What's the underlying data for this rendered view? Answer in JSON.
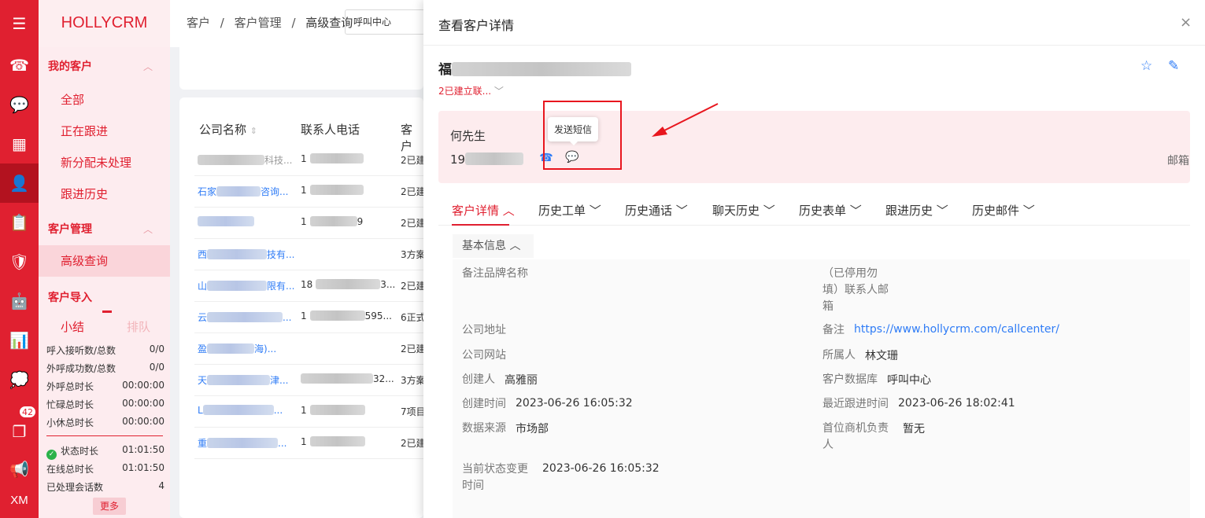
{
  "brand": {
    "logo": "HOLLYCRM"
  },
  "rail": {
    "badge": "42",
    "user_initials": "XM"
  },
  "sidebar": {
    "group_my": "我的客户",
    "my_items": [
      "全部",
      "正在跟进",
      "新分配未处理",
      "跟进历史"
    ],
    "group_manage": "客户管理",
    "manage_items": [
      "高级查询"
    ],
    "group_import": "客户导入"
  },
  "summary": {
    "tab_summary": "小结",
    "tab_queue": "排队",
    "stats": [
      {
        "label": "呼入接听数/总数",
        "value": "0/0"
      },
      {
        "label": "外呼成功数/总数",
        "value": "0/0"
      },
      {
        "label": "外呼总时长",
        "value": "00:00:00"
      },
      {
        "label": "忙碌总时长",
        "value": "00:00:00"
      },
      {
        "label": "小休总时长",
        "value": "00:00:00"
      }
    ],
    "stats2": [
      {
        "label": "状态时长",
        "value": "01:01:50"
      },
      {
        "label": "在线总时长",
        "value": "01:01:50"
      },
      {
        "label": "已处理会话数",
        "value": "4"
      }
    ],
    "more": "更多"
  },
  "breadcrumb": {
    "a": "客户",
    "sep": "/",
    "b": "客户管理",
    "c": "高级查询"
  },
  "top_select": "呼叫中心",
  "table": {
    "headers": [
      "公司名称",
      "联系人电话",
      "客户"
    ],
    "rows": [
      {
        "name": "科技...",
        "phone": "1",
        "status": "2已建"
      },
      {
        "name": "石家",
        "name_tail": "咨询...",
        "phone": "1",
        "status": "2已建"
      },
      {
        "name": "",
        "name_tail": "",
        "phone": "1",
        "phone_tail": "9",
        "status": "2已建"
      },
      {
        "name": "西",
        "name_tail": "技有...",
        "phone": "",
        "status": "3方案"
      },
      {
        "name": "山",
        "name_tail": "限有...",
        "phone": "18",
        "phone_tail": "3...",
        "status": "2已建"
      },
      {
        "name": "云",
        "name_tail": "...",
        "phone": "1",
        "phone_tail": "595...",
        "status": "6正式"
      },
      {
        "name": "盈",
        "name_tail": "海)...",
        "phone": "",
        "status": "2已建"
      },
      {
        "name": "天",
        "name_tail": "津...",
        "phone": "",
        "phone_tail": "32...",
        "status": "3方案"
      },
      {
        "name": "L",
        "name_tail": "...",
        "phone": "1",
        "status": "7项目"
      },
      {
        "name": "重",
        "name_tail": "...",
        "phone": "1",
        "status": "2已建"
      }
    ]
  },
  "drawer": {
    "title": "查看客户详情",
    "close": "×",
    "customer_name": "福",
    "relation": "2已建立联...",
    "contact_name": "何先生",
    "phone_prefix": "19",
    "email_label": "邮箱",
    "tooltip": "发送短信",
    "tabs": [
      "客户详情",
      "历史工单",
      "历史通话",
      "聊天历史",
      "历史表单",
      "跟进历史",
      "历史邮件"
    ],
    "section": "基本信息",
    "fields": {
      "brand_label": "备注品牌名称",
      "stopped_label": "（已停用勿填）联系人邮箱",
      "addr_label": "公司地址",
      "remark_label": "备注",
      "remark_value": "https://www.hollycrm.com/callcenter/",
      "site_label": "公司网站",
      "owner_label": "所属人",
      "owner_value": "林文珊",
      "creator_label": "创建人",
      "creator_value": "高雅丽",
      "db_label": "客户数据库",
      "db_value": "呼叫中心",
      "ctime_label": "创建时间",
      "ctime_value": "2023-06-26 16:05:32",
      "ftime_label": "最近跟进时间",
      "ftime_value": "2023-06-26 18:02:41",
      "source_label": "数据来源",
      "source_value": "市场部",
      "lead_label": "首位商机负责人",
      "lead_value": "暂无",
      "state_label": "当前状态变更时间",
      "state_value": "2023-06-26 16:05:32"
    }
  },
  "colors": {
    "brand_red": "#e02030",
    "link_blue": "#2f7cf6",
    "card_pink": "#fdecee"
  }
}
